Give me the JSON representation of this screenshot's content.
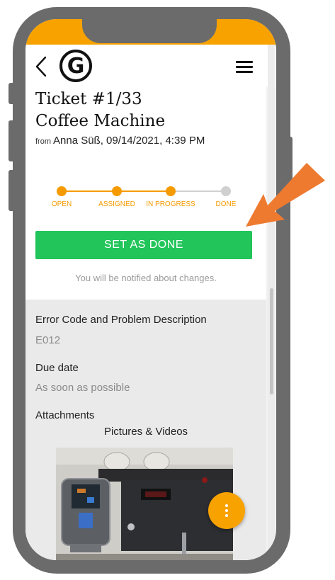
{
  "header": {
    "logo_letter": "G"
  },
  "ticket": {
    "title": "Ticket #1/33",
    "subtitle": "Coffee Machine",
    "from_label": "from",
    "author_date": "Anna Süß, 09/14/2021, 4:39 PM"
  },
  "progress": {
    "steps": [
      "OPEN",
      "ASSIGNED",
      "IN PROGRESS",
      "DONE"
    ],
    "current_step": 3,
    "active_color": "#f59b00",
    "inactive_color": "#d0d0d0"
  },
  "action": {
    "button_label": "SET AS DONE",
    "button_color": "#22c55a",
    "notify_text": "You will be notified about changes."
  },
  "details": {
    "error_label": "Error Code and Problem Description",
    "error_value": "E012",
    "due_label": "Due date",
    "due_value": "As soon as possible",
    "attachments_label": "Attachments",
    "attachments_sub": "Pictures & Videos"
  },
  "colors": {
    "brand": "#f8a200",
    "frame": "#6b6b6b",
    "annotation_arrow": "#ee7a30"
  },
  "icons": {
    "back": "chevron-left-icon",
    "menu": "hamburger-menu-icon",
    "fab": "more-vertical-icon"
  }
}
